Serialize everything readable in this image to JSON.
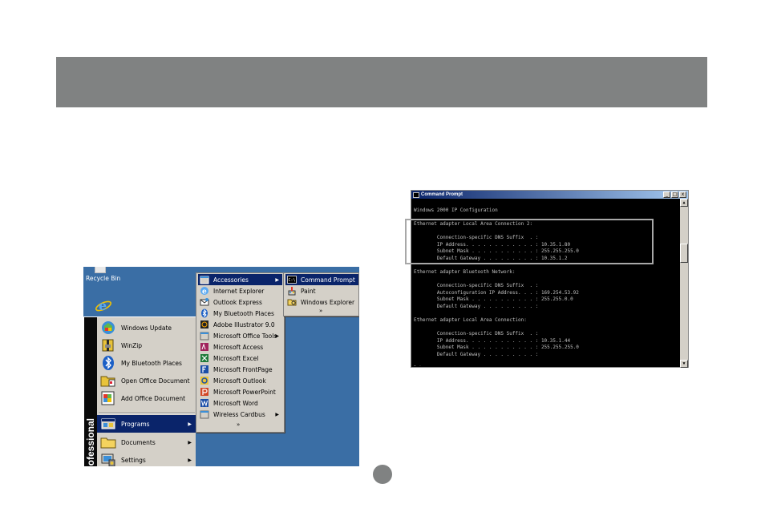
{
  "desktop": {
    "recycle_bin_label": "Recycle Bin"
  },
  "start_menu": {
    "brand_text": "ofessional",
    "top_items": [
      {
        "label": "Windows Update",
        "icon": "windows-update-icon"
      },
      {
        "label": "WinZip",
        "icon": "winzip-icon"
      },
      {
        "label": "My Bluetooth Places",
        "icon": "bluetooth-icon"
      },
      {
        "label": "Open Office Document",
        "icon": "open-office-document-icon"
      },
      {
        "label": "Add Office Document",
        "icon": "add-office-document-icon"
      }
    ],
    "bottom_items": [
      {
        "label": "Programs",
        "icon": "programs-icon",
        "selected": true
      },
      {
        "label": "Documents",
        "icon": "documents-icon"
      },
      {
        "label": "Settings",
        "icon": "settings-icon"
      }
    ]
  },
  "programs_menu": {
    "items": [
      {
        "label": "Accessories",
        "icon": "folder-icon",
        "selected": true,
        "submenu": true
      },
      {
        "label": "Internet Explorer",
        "icon": "internet-explorer-icon"
      },
      {
        "label": "Outlook Express",
        "icon": "outlook-express-icon"
      },
      {
        "label": "My Bluetooth Places",
        "icon": "bluetooth-icon"
      },
      {
        "label": "Adobe Illustrator 9.0",
        "icon": "adobe-illustrator-icon"
      },
      {
        "label": "Microsoft Office Tools",
        "icon": "folder-icon",
        "submenu": true
      },
      {
        "label": "Microsoft Access",
        "icon": "microsoft-access-icon"
      },
      {
        "label": "Microsoft Excel",
        "icon": "microsoft-excel-icon"
      },
      {
        "label": "Microsoft FrontPage",
        "icon": "microsoft-frontpage-icon"
      },
      {
        "label": "Microsoft Outlook",
        "icon": "microsoft-outlook-icon"
      },
      {
        "label": "Microsoft PowerPoint",
        "icon": "microsoft-powerpoint-icon"
      },
      {
        "label": "Microsoft Word",
        "icon": "microsoft-word-icon"
      },
      {
        "label": "Wireless Cardbus",
        "icon": "folder-icon",
        "submenu": true
      }
    ],
    "more_glyph": "»"
  },
  "accessories_menu": {
    "items": [
      {
        "label": "Command Prompt",
        "icon": "command-prompt-icon",
        "selected": true
      },
      {
        "label": "Paint",
        "icon": "paint-icon"
      },
      {
        "label": "Windows Explorer",
        "icon": "windows-explorer-icon"
      }
    ],
    "more_glyph": "»"
  },
  "cmd_window": {
    "title": "Command Prompt",
    "min_glyph": "_",
    "max_glyph": "□",
    "close_glyph": "x",
    "lines": [
      "",
      "Windows 2000 IP Configuration",
      "",
      "Ethernet adapter Local Area Connection 2:",
      "",
      "        Connection-specific DNS Suffix  . :",
      "        IP Address. . . . . . . . . . . . : 10.35.1.80",
      "        Subnet Mask . . . . . . . . . . . : 255.255.255.0",
      "        Default Gateway . . . . . . . . . : 10.35.1.2",
      "",
      "Ethernet adapter Bluetooth Network:",
      "",
      "        Connection-specific DNS Suffix  . :",
      "        Autoconfiguration IP Address. . . : 169.254.53.92",
      "        Subnet Mask . . . . . . . . . . . : 255.255.0.0",
      "        Default Gateway . . . . . . . . . :",
      "",
      "Ethernet adapter Local Area Connection:",
      "",
      "        Connection-specific DNS Suffix  . :",
      "        IP Address. . . . . . . . . . . . : 10.35.1.44",
      "        Subnet Mask . . . . . . . . . . . : 255.255.255.0",
      "        Default Gateway . . . . . . . . . :",
      "",
      "D:\\>_"
    ]
  },
  "colors": {
    "header_bar": "#808282",
    "desktop": "#3a6ea5",
    "menu_bg": "#d4d0c8",
    "selection": "#0a246a",
    "console_text": "#c0c0c0"
  }
}
